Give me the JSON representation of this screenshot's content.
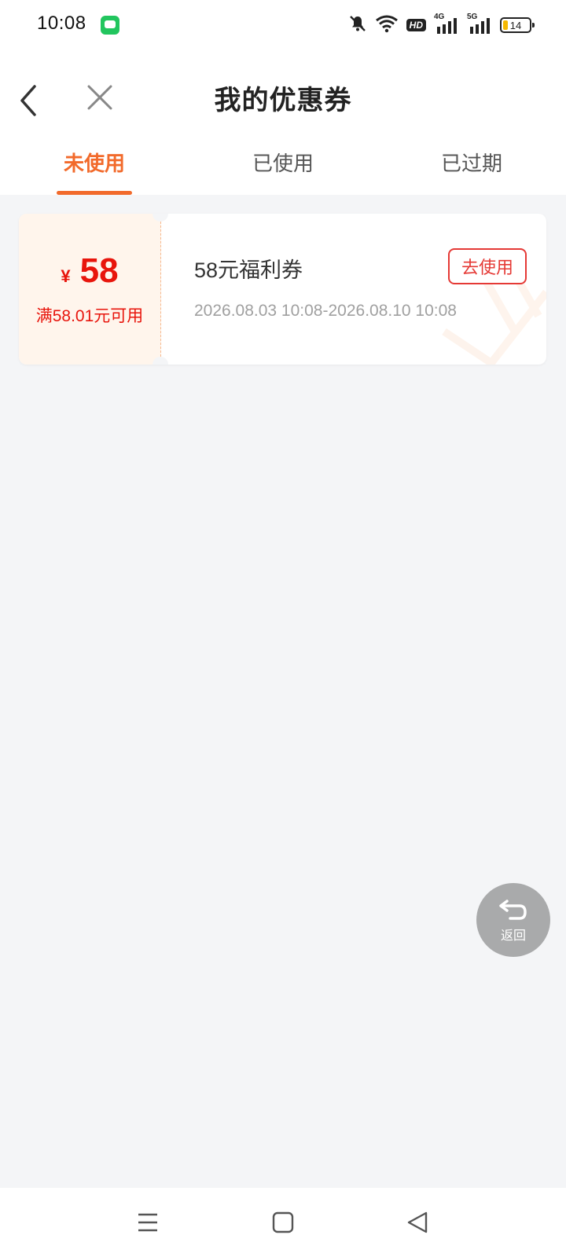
{
  "status_bar": {
    "time": "10:08",
    "network_4g": "4G",
    "network_5g": "5G",
    "hd_label": "HD",
    "battery_level": "14"
  },
  "header": {
    "title": "我的优惠券"
  },
  "tabs": [
    {
      "label": "未使用",
      "active": true
    },
    {
      "label": "已使用",
      "active": false
    },
    {
      "label": "已过期",
      "active": false
    }
  ],
  "coupons": [
    {
      "currency_symbol": "¥",
      "amount": "58",
      "condition": "满58.01元可用",
      "name": "58元福利券",
      "validity": "2026.08.03 10:08-2026.08.10 10:08",
      "action_label": "去使用"
    }
  ],
  "float_back": {
    "label": "返回"
  },
  "colors": {
    "accent": "#f26a2b",
    "coupon_red": "#e8150c",
    "page_bg": "#f4f5f7"
  }
}
